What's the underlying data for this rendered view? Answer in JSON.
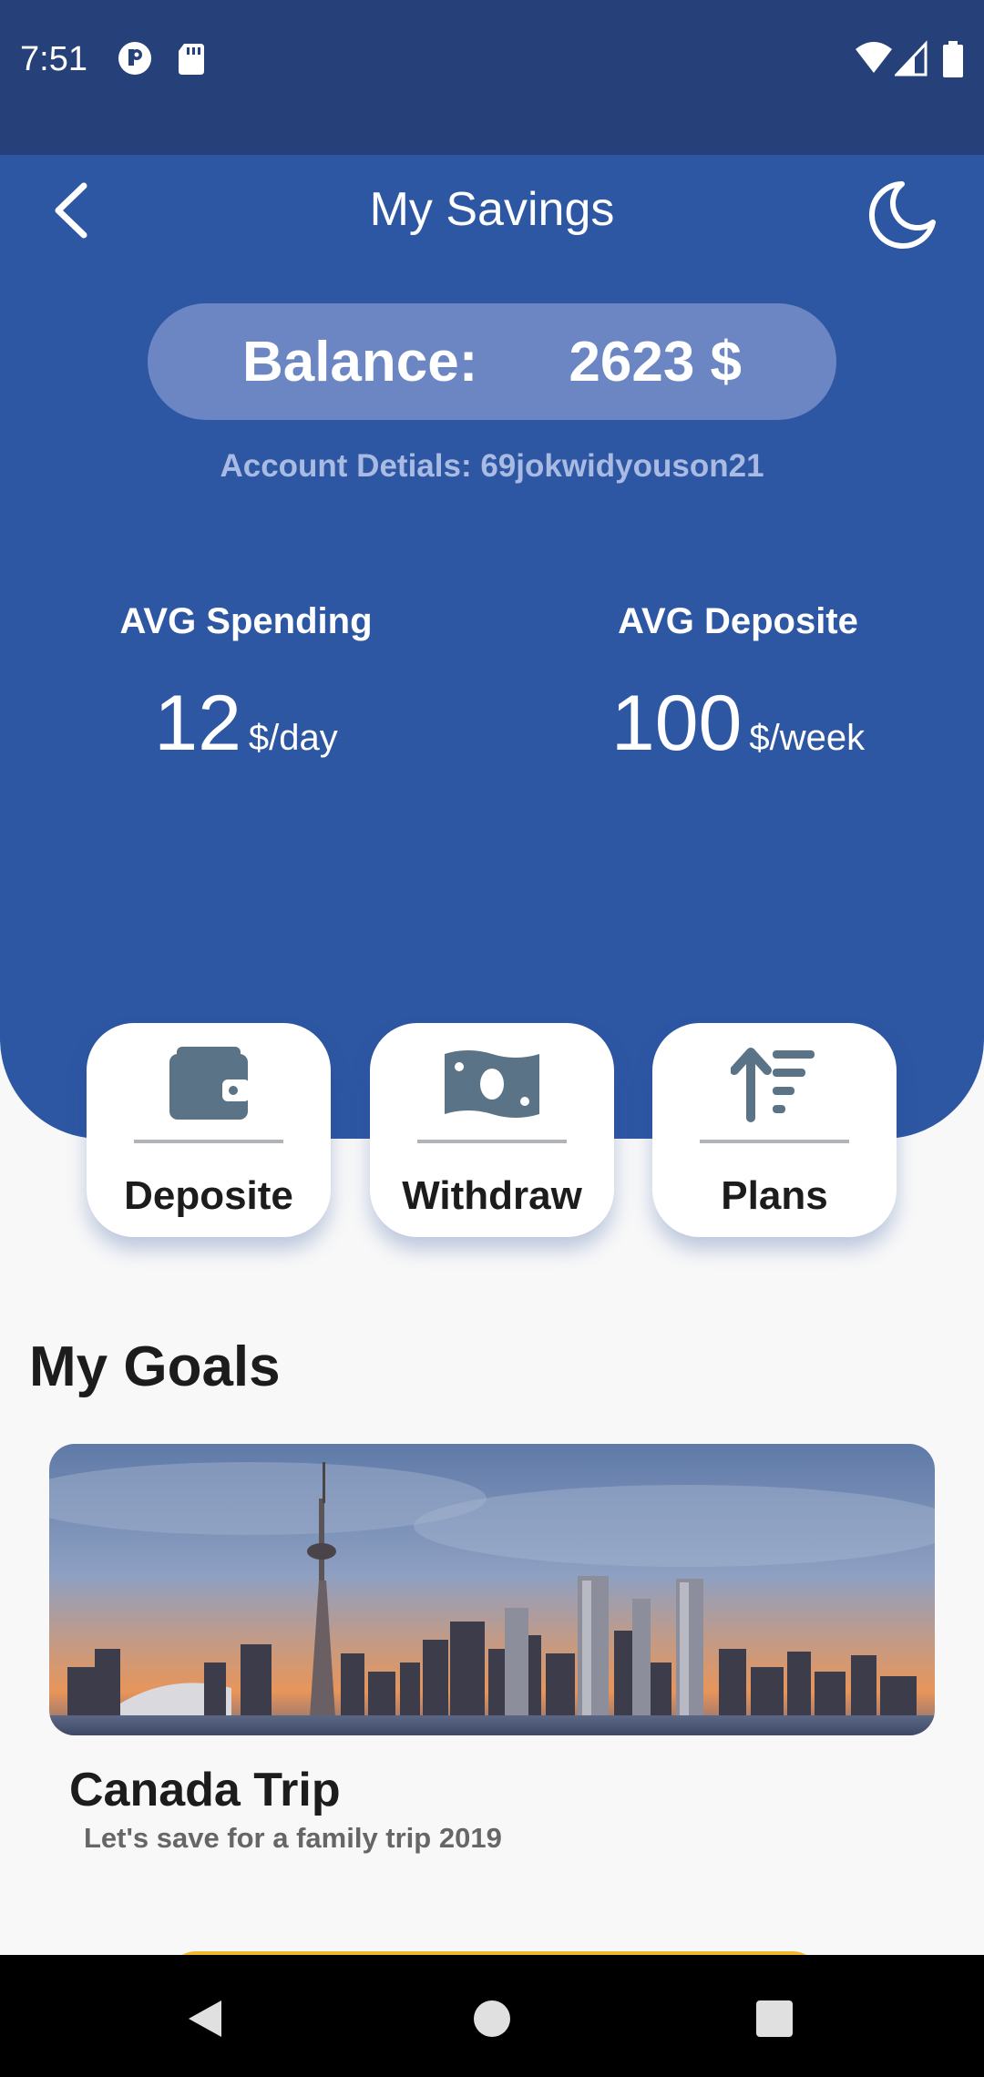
{
  "status_bar": {
    "time": "7:51"
  },
  "header": {
    "title": "My Savings",
    "balance_label": "Balance:",
    "balance_value": "2623 $",
    "account_details": "Account Detials: 69jokwidyouson21",
    "spending": {
      "label": "AVG Spending",
      "value": "12",
      "unit": "$/day"
    },
    "deposit": {
      "label": "AVG Deposite",
      "value": "100",
      "unit": "$/week"
    }
  },
  "actions": [
    {
      "label": "Deposite",
      "icon": "wallet-icon"
    },
    {
      "label": "Withdraw",
      "icon": "money-icon"
    },
    {
      "label": "Plans",
      "icon": "sort-icon"
    }
  ],
  "goals": {
    "heading": "My Goals",
    "items": [
      {
        "title": "Canada Trip",
        "subtitle": "Let's save for a family trip 2019",
        "image": "toronto-skyline-image"
      }
    ]
  },
  "colors": {
    "status_bar": "#26407a",
    "header": "#2d56a3",
    "balance_pill": "#6b86c2",
    "icon": "#5a7386",
    "accent": "#f2b72b"
  }
}
